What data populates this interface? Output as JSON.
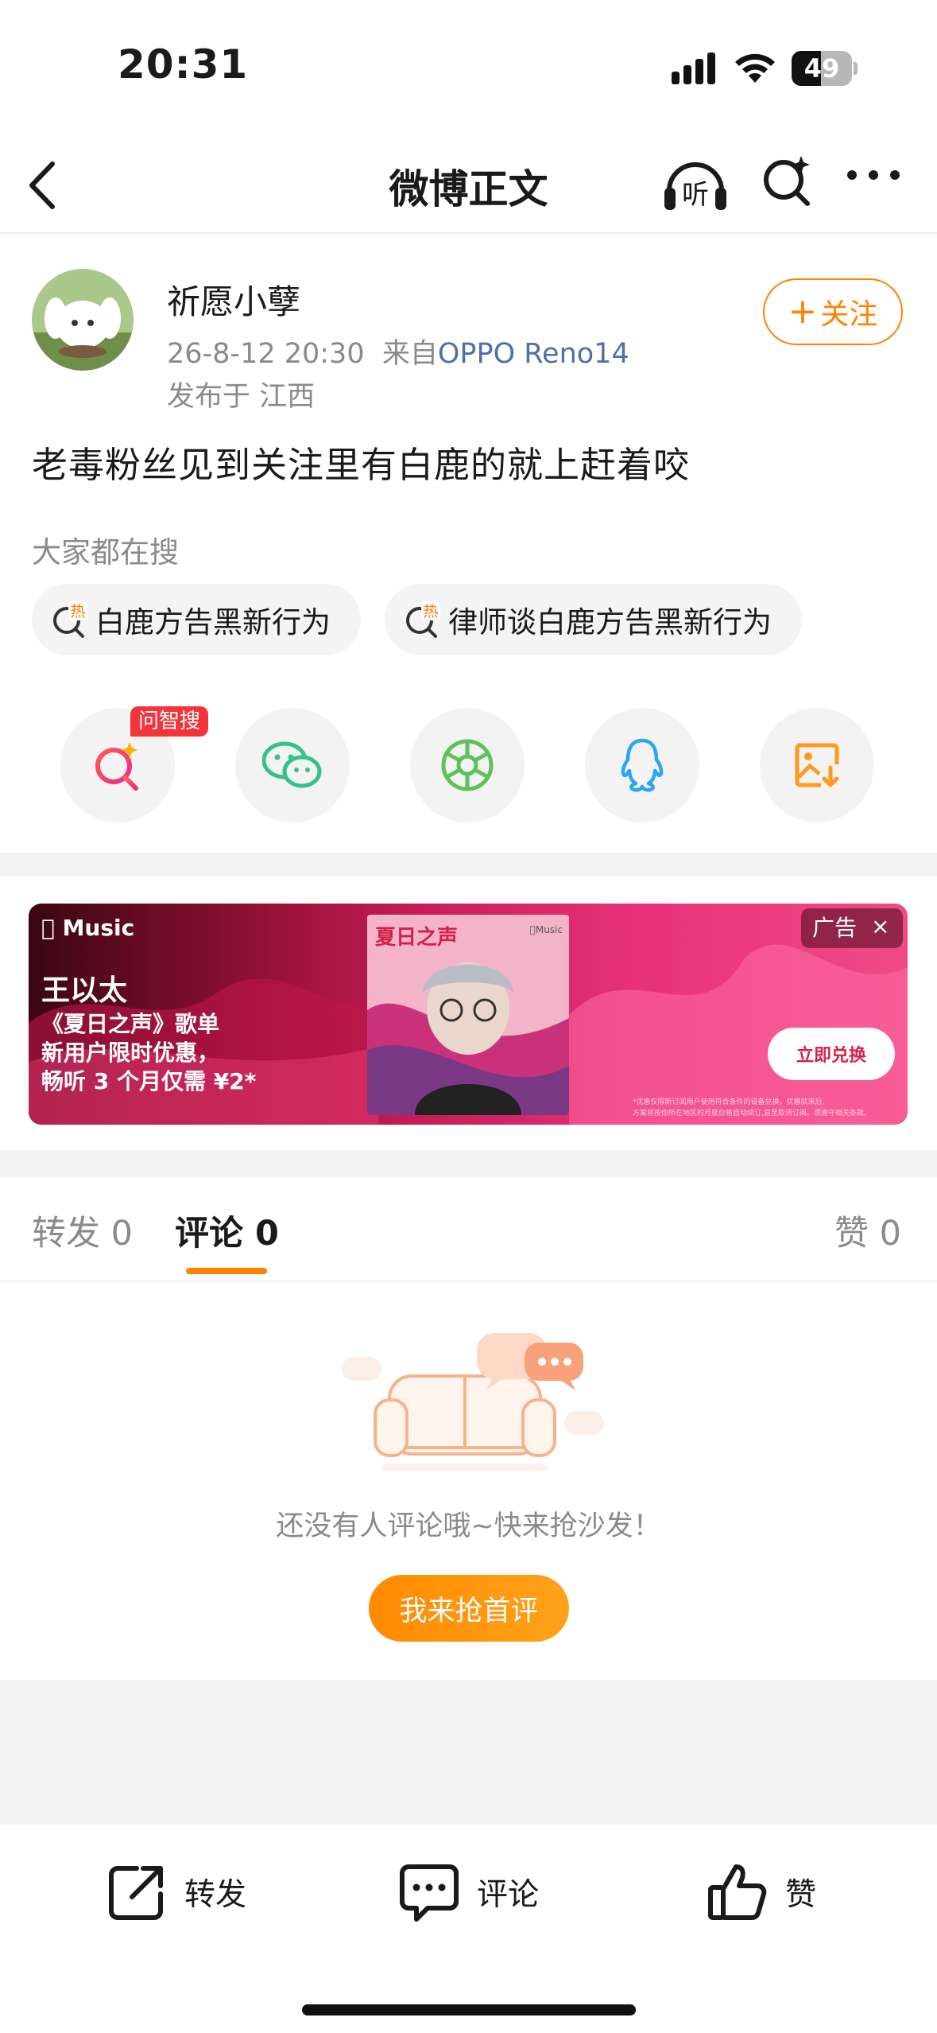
{
  "status_bar": {
    "time": "20:31",
    "battery": "49",
    "battery_level": 0.49
  },
  "nav": {
    "title": "微博正文",
    "listen_label": "听"
  },
  "post": {
    "username": "祈愿小孽",
    "timestamp": "26-8-12 20:30",
    "source_prefix": "来自",
    "device": "OPPO Reno14",
    "location": "发布于 江西",
    "follow_label": "关注",
    "follow_plus": "+",
    "text": "老毒粉丝见到关注里有白鹿的就上赶着咬"
  },
  "hot_search": {
    "title": "大家都在搜",
    "badge": "热",
    "items": [
      "白鹿方告黑新行为",
      "律师谈白鹿方告黑新行为"
    ]
  },
  "share": {
    "ai_badge": "问智搜"
  },
  "ad": {
    "brand": "Music",
    "artist": "王以太",
    "lines": [
      "《夏日之声》歌单",
      "新用户限时优惠，",
      "畅听 3 个月仅需 ¥2*"
    ],
    "album_title": "夏日之声",
    "album_label": "Music",
    "label": "广告",
    "close": "×",
    "cta": "立即兑换",
    "fine_print": [
      "*优惠仅限新订阅用户使用符合条件的设备兑换。优惠就来后,",
      "方案将按你所在地区的月度价格自动续订,直至取消订阅。须遵守相关条款。"
    ]
  },
  "tabs": {
    "repost": "转发 0",
    "comment": "评论 0",
    "like": "赞 0"
  },
  "empty_state": {
    "text": "还没有人评论哦~快来抢沙发！",
    "button": "我来抢首评"
  },
  "bottom_bar": {
    "repost": "转发",
    "comment": "评论",
    "like": "赞"
  },
  "colors": {
    "accent": "#ff8200",
    "link": "#4f6fa8",
    "hot_red": "#f4333a"
  }
}
